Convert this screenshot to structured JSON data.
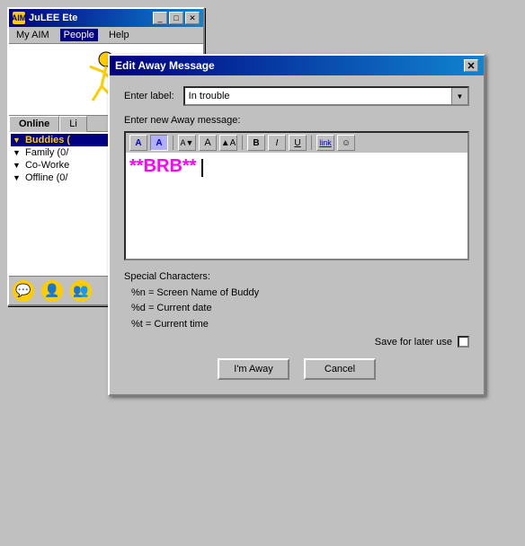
{
  "aim_window": {
    "title": "JuLEE Ete",
    "title_icon": "AIM",
    "menu_items": [
      "My AIM",
      "People",
      "Help"
    ],
    "tabs": [
      {
        "label": "Online",
        "active": true
      },
      {
        "label": "Li",
        "active": false
      }
    ],
    "buddy_groups": [
      {
        "label": "Buddies (",
        "active": true,
        "arrow": "▼"
      },
      {
        "label": "Family (0/",
        "active": false,
        "arrow": "▼"
      },
      {
        "label": "Co-Worke",
        "active": false,
        "arrow": "▼"
      },
      {
        "label": "Offline (0/",
        "active": false,
        "arrow": "▼"
      }
    ],
    "titlebar_buttons": [
      "_",
      "□",
      "✕"
    ]
  },
  "dialog": {
    "title": "Edit Away Message",
    "close_btn": "✕",
    "label_enter_label": "Enter label:",
    "dropdown_value": "In trouble",
    "label_enter_message": "Enter new Away message:",
    "message_text": "**BRB**",
    "special_chars_title": "Special Characters:",
    "special_chars": [
      "%n  =  Screen Name of Buddy",
      "%d  =  Current date",
      "%t   =  Current time"
    ],
    "save_label": "Save for later use",
    "btn_away": "I'm Away",
    "btn_cancel": "Cancel",
    "toolbar_buttons": [
      {
        "label": "A",
        "style": "blue-bold",
        "name": "font-color-btn"
      },
      {
        "label": "A",
        "style": "blue-bg",
        "name": "font-bg-btn"
      },
      {
        "label": "A▼",
        "style": "size-down",
        "name": "font-size-down-btn"
      },
      {
        "label": "A",
        "style": "normal",
        "name": "font-normal-btn"
      },
      {
        "label": "▲A",
        "style": "size-up",
        "name": "font-size-up-btn"
      },
      {
        "label": "B",
        "style": "bold",
        "name": "bold-btn"
      },
      {
        "label": "I",
        "style": "italic",
        "name": "italic-btn"
      },
      {
        "label": "U",
        "style": "underline",
        "name": "underline-btn"
      },
      {
        "label": "link",
        "style": "link",
        "name": "link-btn"
      },
      {
        "label": "☺",
        "style": "smiley",
        "name": "smiley-btn"
      }
    ]
  },
  "statusbar": {
    "icons": [
      "chat-icon",
      "buddy-icon",
      "add-icon"
    ]
  }
}
